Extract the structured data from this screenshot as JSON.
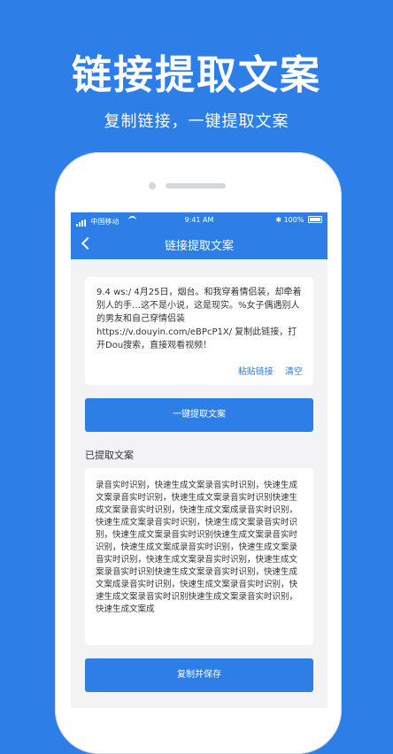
{
  "hero": {
    "title": "链接提取文案",
    "subtitle": "复制链接，一键提取文案"
  },
  "status_bar": {
    "carrier": "中国移动",
    "time": "9:41 AM",
    "battery": "100%"
  },
  "nav": {
    "title": "链接提取文案"
  },
  "link_input": {
    "text": "9.4 ws:/ 4月25日，烟台。和我穿着情侣装，却牵着别人的手…这不是小说，这是现实。%女子偶遇别人的男友和自己穿情侣装 https://v.douyin.com/eBPcP1X/ 复制此链接，打开Dou搜索，直接观看视频！",
    "paste_label": "粘贴链接",
    "clear_label": "清空"
  },
  "extract_button": {
    "label": "一键提取文案"
  },
  "extracted_section": {
    "label": "已提取文案",
    "text": "录音实时识别，快速生成文案录音实时识别，快速生成文案录音实时识别，快速生成文案录音实时识别快速生成文案录音实时识别，快速生成文案成录音实时识别，快速生成文案录音实时识别，快速生成文案录音实时识别，快速生成文案录音实时识别快速生成文案录音实时识别，快速生成文案成录音实时识别，快速生成文案录音实时识别，快速生成文案录音实时识别，快速生成文案录音实时识别快速生成文案录音实时识别，快速生成文案成录音实时识别，快速生成文案录音实时识别，快速生成文案录音实时识别快速生成文案录音实时识别，快速生成文案成"
  },
  "save_button": {
    "label": "复制并保存"
  }
}
